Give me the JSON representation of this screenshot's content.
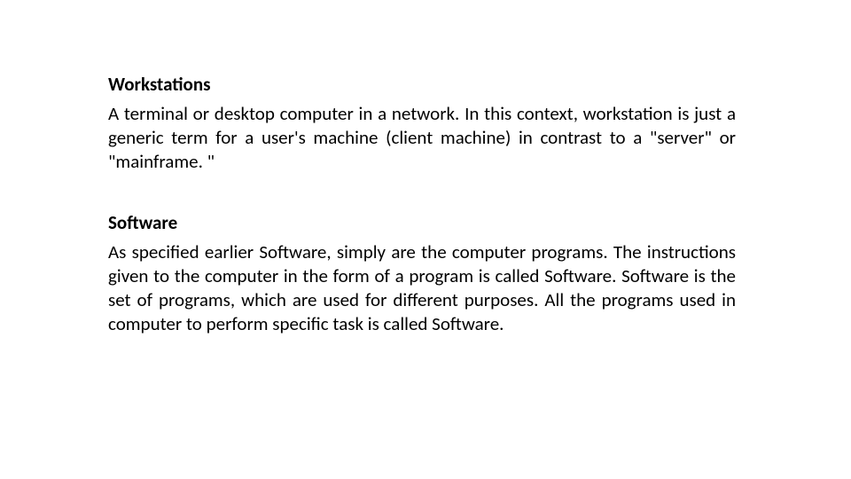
{
  "sections": [
    {
      "heading": "Workstations",
      "body": "A terminal or desktop computer in a network. In this context, workstation is just a generic term for a user's machine (client machine) in contrast to a \"server\" or \"mainframe. \""
    },
    {
      "heading": "Software",
      "body": "As specified earlier Software, simply are the computer programs. The instructions given to the computer in the form of a program is called Software. Software is the set of programs, which are used for different purposes. All the programs used in computer to perform specific task is called Software."
    }
  ]
}
